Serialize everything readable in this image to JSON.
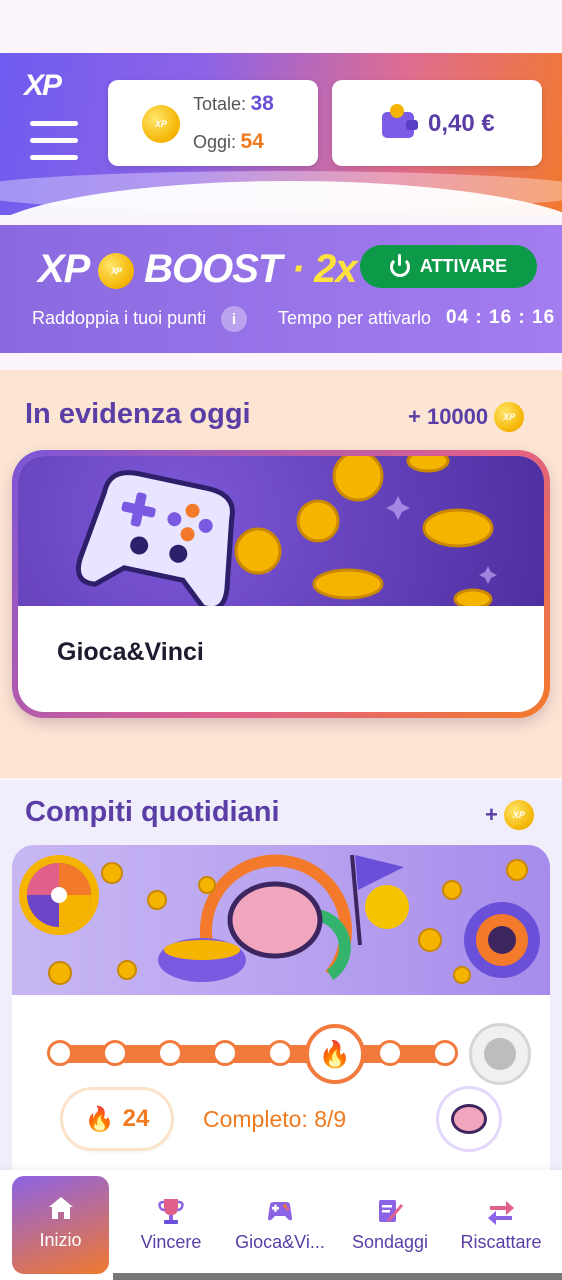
{
  "header": {
    "logo": "XP",
    "points": {
      "total_label": "Totale:",
      "total_value": "38",
      "today_label": "Oggi:",
      "today_value": "54"
    },
    "balance": "0,40 €"
  },
  "boost": {
    "title_a": "XP",
    "title_b": "BOOST",
    "title_sep": "·",
    "multiplier": "2x",
    "activate_label": "ATTIVARE",
    "subtitle": "Raddoppia i tuoi punti",
    "info_glyph": "i",
    "timer_label": "Tempo per attivarlo",
    "timer_value": "04 : 16 : 16"
  },
  "featured": {
    "title": "In evidenza oggi",
    "bonus": "+ 10000",
    "game_label": "Gioca&Vinci"
  },
  "daily": {
    "title": "Compiti quotidiani",
    "bonus": "+",
    "streak_value": "24",
    "completed": "Completo: 8/9",
    "progress": {
      "completed": 8,
      "total": 9
    }
  },
  "nav": {
    "items": [
      {
        "label": "Inizio",
        "icon": "home-icon",
        "active": true
      },
      {
        "label": "Vincere",
        "icon": "trophy-icon"
      },
      {
        "label": "Gioca&Vi...",
        "icon": "gamepad-icon"
      },
      {
        "label": "Sondaggi",
        "icon": "survey-icon"
      },
      {
        "label": "Riscattare",
        "icon": "exchange-icon"
      }
    ]
  },
  "colors": {
    "accent": "#5a3ea6",
    "orange": "#f07a20",
    "green": "#0c9a48"
  }
}
